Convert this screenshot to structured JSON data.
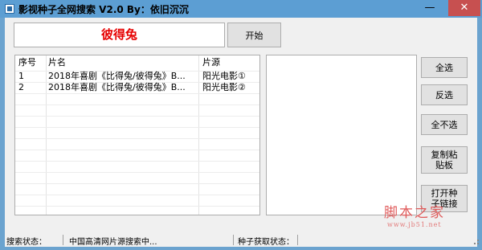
{
  "titlebar": {
    "title": "影视种子全网搜索 V2.0 By：依旧沉沉",
    "min": "—",
    "max": "□",
    "close": "✕"
  },
  "search": {
    "value": "彼得兔",
    "start_label": "开始"
  },
  "results": {
    "columns": [
      "序号",
      "片名",
      "片源"
    ],
    "rows": [
      [
        "1",
        "2018年喜剧《比得兔/彼得兔》B...",
        "阳光电影①"
      ],
      [
        "2",
        "2018年喜剧《比得兔/彼得兔》B...",
        "阳光电影②"
      ]
    ]
  },
  "side_buttons": {
    "select_all": "全选",
    "invert": "反选",
    "select_none": "全不选",
    "copy_paste": "复制粘\n贴板",
    "open_seed": "打开种\n子链接"
  },
  "status": {
    "search_label": "搜索状态：",
    "search_value": "中国高清网片源搜索中...",
    "seed_label": "种子获取状态："
  },
  "watermark": {
    "main": "脚本之家",
    "sub": "www.jb51.net"
  }
}
